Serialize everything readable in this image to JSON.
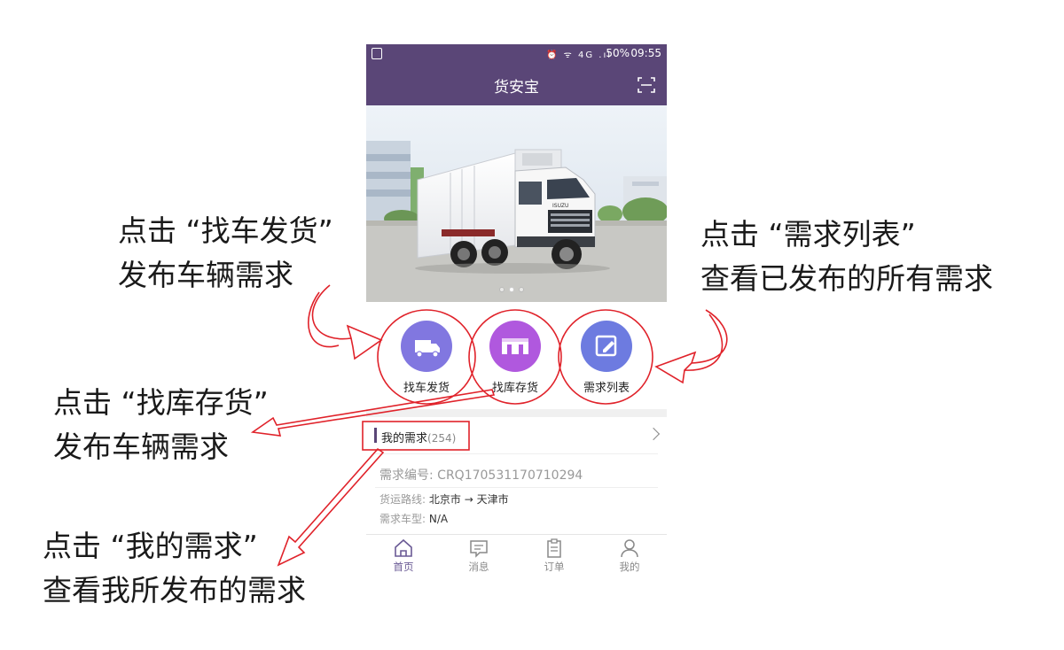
{
  "captions": {
    "find_truck": [
      "点击 “找车发货”",
      "发布车辆需求"
    ],
    "demand_list": [
      "点击 “需求列表”",
      "查看已发布的所有需求"
    ],
    "find_warehouse": [
      "点击 “找库存货”",
      "发布车辆需求"
    ],
    "my_demand": [
      "点击 “我的需求”",
      "查看我所发布的需求"
    ]
  },
  "status_bar": {
    "signal": "⏰ ᯤ 4G .ıl",
    "battery": "50%",
    "time": "09:55"
  },
  "app": {
    "title": "货安宝"
  },
  "banner": {
    "truck_brand": "ISUZU",
    "slides": 3,
    "active_slide": 2
  },
  "quick_actions": [
    {
      "label": "找车发货",
      "color": "#8177e0",
      "icon": "truck-icon"
    },
    {
      "label": "找库存货",
      "color": "#b058de",
      "icon": "warehouse-icon"
    },
    {
      "label": "需求列表",
      "color": "#6d7be0",
      "icon": "edit-icon"
    }
  ],
  "my_demand": {
    "label": "我的需求",
    "count": "(254)"
  },
  "demand_item": {
    "order_no": "需求编号: CRQ170531170710294",
    "route_label": "货运路线: ",
    "route_from": "北京市",
    "route_arrow": "→",
    "route_to": "天津市",
    "vehicle_label": "需求车型: ",
    "vehicle_value": "N/A"
  },
  "tabs": [
    {
      "label": "首页",
      "icon": "home-icon",
      "active": true
    },
    {
      "label": "消息",
      "icon": "message-icon",
      "active": false
    },
    {
      "label": "订单",
      "icon": "clipboard-icon",
      "active": false
    },
    {
      "label": "我的",
      "icon": "user-icon",
      "active": false
    }
  ],
  "colors": {
    "brand": "#5a4677",
    "annotation": "#e0222a"
  }
}
